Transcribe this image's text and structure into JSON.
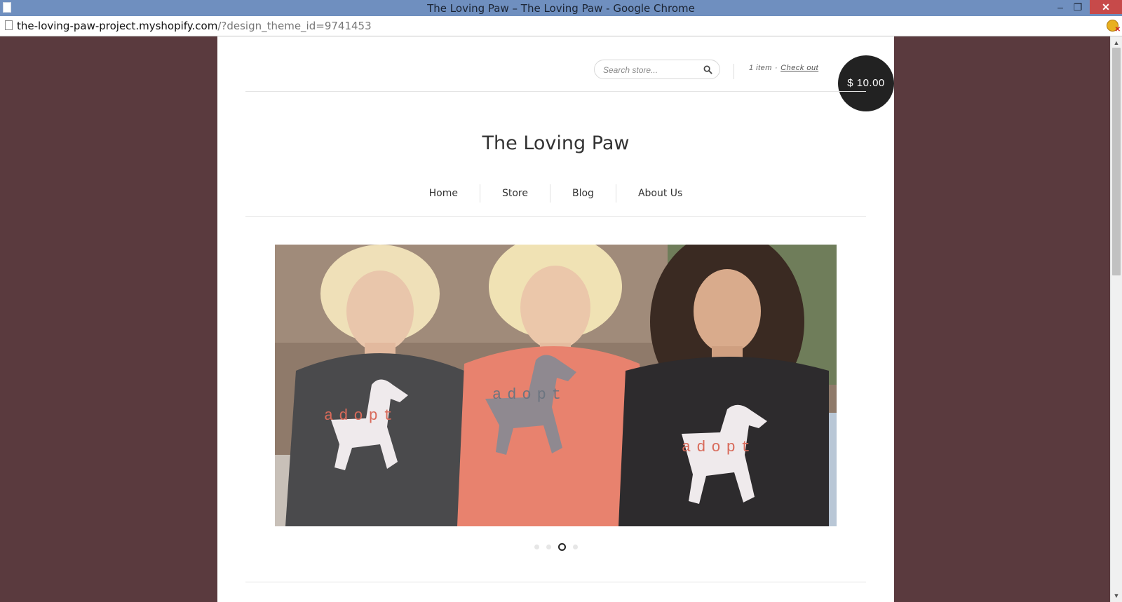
{
  "browser": {
    "window_title": "The Loving Paw – The Loving Paw - Google Chrome",
    "url_host": "the-loving-paw-project.myshopify.com",
    "url_path": "/?design_theme_id=9741453",
    "window_buttons": {
      "minimize": "–",
      "restore": "❐",
      "close": "✕"
    }
  },
  "header": {
    "search_placeholder": "Search store...",
    "cart_count": "1 item",
    "cart_separator": "·",
    "checkout_label": "Check out",
    "cart_total": "$ 10.00"
  },
  "store": {
    "title": "The Loving Paw"
  },
  "nav": {
    "items": [
      {
        "label": "Home"
      },
      {
        "label": "Store"
      },
      {
        "label": "Blog"
      },
      {
        "label": "About Us"
      }
    ]
  },
  "slideshow": {
    "slide_count": 4,
    "active_index": 2,
    "shirt_text": [
      "adopt",
      "adopt",
      "adopt"
    ]
  },
  "colors": {
    "window_titlebar": "#6f8fbf",
    "page_background": "#5a3a3e",
    "cart_bubble": "#222222",
    "shirt_gray": "#4a4a4c",
    "shirt_coral": "#e8826e",
    "shirt_charcoal": "#2d2b2d"
  }
}
